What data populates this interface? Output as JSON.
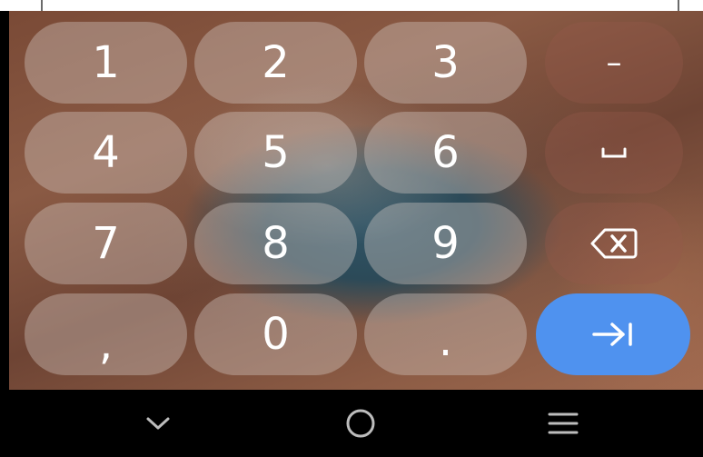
{
  "keyboard": {
    "digits": [
      "1",
      "2",
      "3",
      "4",
      "5",
      "6",
      "7",
      "8",
      "9",
      "0"
    ],
    "comma_label": ",",
    "period_label": ".",
    "dash_label": "–",
    "space_label": "␣"
  },
  "colors": {
    "action_key": "#4f92ef",
    "key_bg": "rgba(215,205,200,0.38)"
  },
  "icons": {
    "backspace": "backspace-icon",
    "enter": "tab-enter-icon",
    "nav_back": "chevron-down-icon",
    "nav_home": "home-circle-icon",
    "nav_recent": "menu-lines-icon"
  }
}
